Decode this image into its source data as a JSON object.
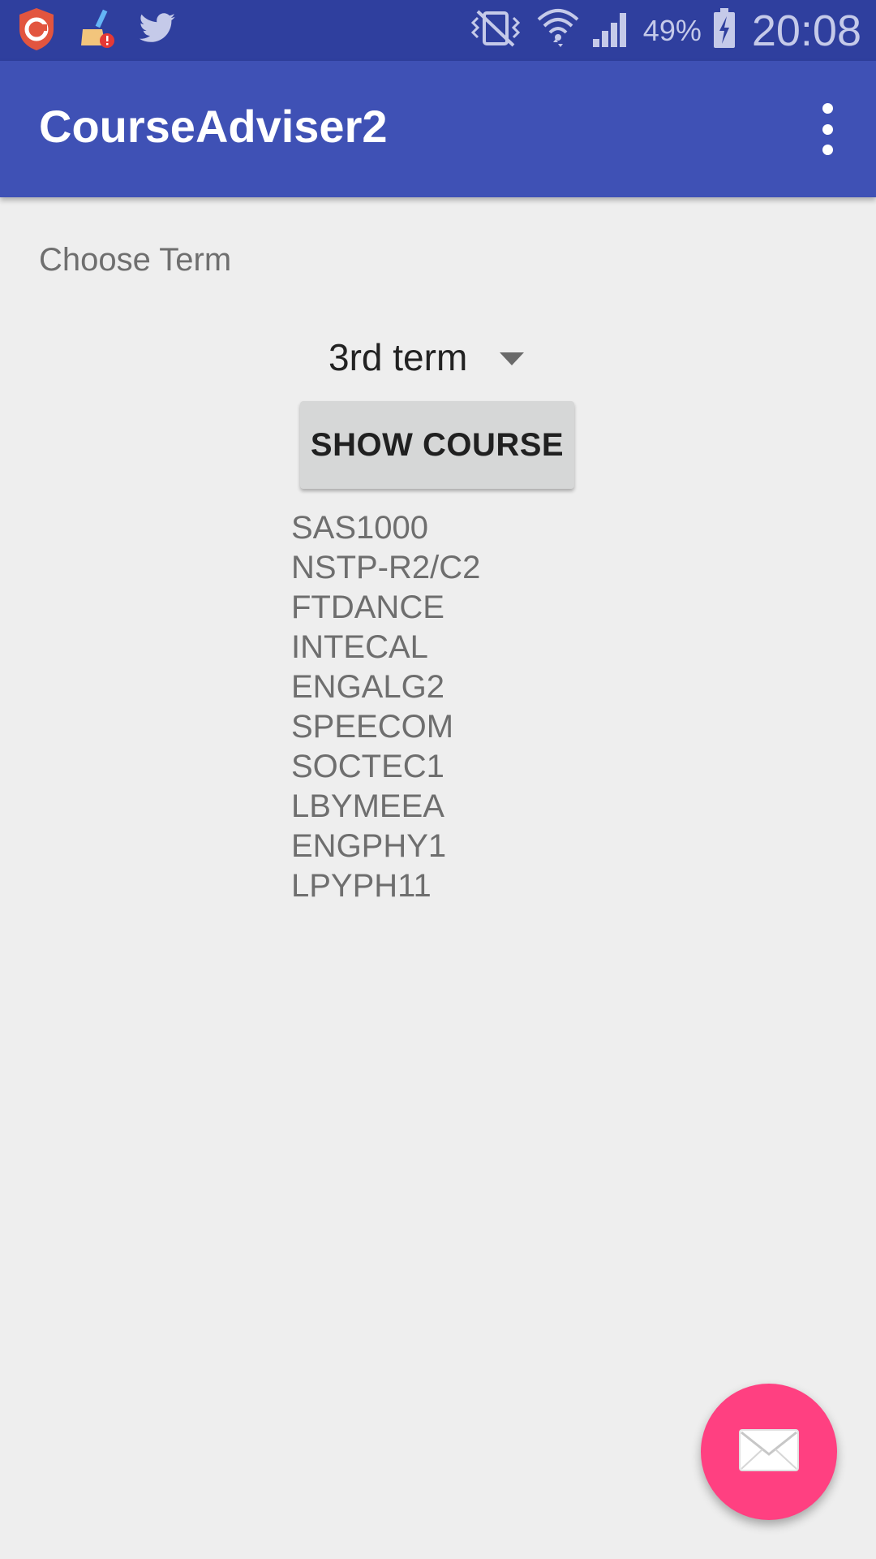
{
  "status_bar": {
    "battery": "49%",
    "time": "20:08",
    "icons": [
      "security-app-icon",
      "cleaner-app-icon",
      "twitter-icon",
      "vibrate-icon",
      "wifi-icon",
      "signal-icon",
      "battery-charging-icon"
    ]
  },
  "app_bar": {
    "title": "CourseAdviser2",
    "overflow_icon": "more-vert-icon"
  },
  "main": {
    "choose_label": "Choose Term",
    "term_spinner": {
      "selected": "3rd term"
    },
    "show_button_label": "SHOW COURSE",
    "courses": [
      "SAS1000",
      "NSTP-R2/C2",
      "FTDANCE",
      "INTECAL",
      "ENGALG2",
      "SPEECOM",
      "SOCTEC1",
      "LBYMEEA",
      "ENGPHY1",
      "LPYPH11"
    ]
  },
  "fab": {
    "icon": "mail-icon"
  },
  "colors": {
    "status_bar": "#2f3f9e",
    "app_bar": "#3f51b5",
    "fab": "#ff4081",
    "background": "#eeeeee"
  }
}
